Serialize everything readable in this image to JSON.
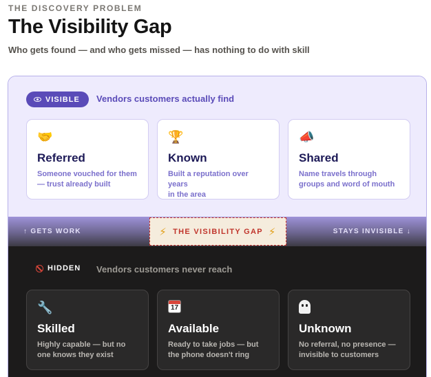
{
  "header": {
    "eyebrow": "THE DISCOVERY PROBLEM",
    "title": "The Visibility Gap",
    "subtitle": "Who gets found — and who gets missed — has nothing to do with skill"
  },
  "visible": {
    "badge": "VISIBLE",
    "badge_icon": "eye-icon",
    "description": "Vendors customers actually find",
    "accent_color": "#5a4bb8",
    "cards": [
      {
        "icon": "🤝",
        "icon_name": "handshake-icon",
        "title": "Referred",
        "line1": "Someone vouched for them",
        "line2": "— trust already built"
      },
      {
        "icon": "🏆",
        "icon_name": "trophy-icon",
        "title": "Known",
        "line1": "Built a reputation over years",
        "line2": "in the area"
      },
      {
        "icon": "📣",
        "icon_name": "megaphone-icon",
        "title": "Shared",
        "line1": "Name travels through",
        "line2": "groups and word of mouth"
      }
    ]
  },
  "divider": {
    "left": "↑ GETS WORK",
    "center": "THE VISIBILITY GAP",
    "bolt": "⚡",
    "right": "STAYS INVISIBLE ↓",
    "alert_color": "#c0352c"
  },
  "hidden": {
    "badge": "HIDDEN",
    "badge_icon": "no-entry-icon",
    "description": "Vendors customers never reach",
    "cards": [
      {
        "icon": "🔧",
        "icon_name": "wrench-icon",
        "title": "Skilled",
        "line1": "Highly capable — but no",
        "line2": "one knows they exist"
      },
      {
        "icon_name": "calendar-icon",
        "calendar_month": "July",
        "calendar_day": "17",
        "title": "Available",
        "line1": "Ready to take jobs — but",
        "line2": "the phone doesn't ring"
      },
      {
        "icon_name": "ghost-icon",
        "title": "Unknown",
        "line1": "No referral, no presence —",
        "line2": "invisible to customers"
      }
    ]
  }
}
